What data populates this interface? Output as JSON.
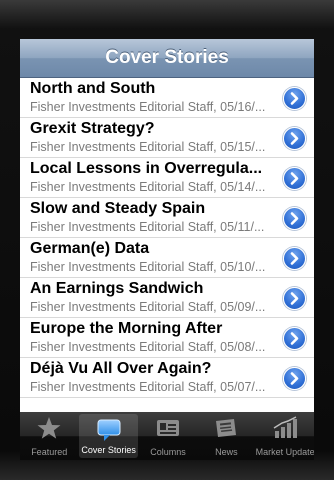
{
  "nav": {
    "title": "Cover Stories"
  },
  "stories": [
    {
      "title": "North and South",
      "subtitle": "Fisher Investments Editorial Staff, 05/16/..."
    },
    {
      "title": "Grexit Strategy?",
      "subtitle": "Fisher Investments Editorial Staff, 05/15/..."
    },
    {
      "title": "Local Lessons in Overregula...",
      "subtitle": "Fisher Investments Editorial Staff, 05/14/..."
    },
    {
      "title": "Slow and Steady Spain",
      "subtitle": "Fisher Investments Editorial Staff, 05/11/..."
    },
    {
      "title": "German(e) Data",
      "subtitle": "Fisher Investments Editorial Staff, 05/10/..."
    },
    {
      "title": "An Earnings Sandwich",
      "subtitle": "Fisher Investments Editorial Staff, 05/09/..."
    },
    {
      "title": "Europe the Morning After",
      "subtitle": "Fisher Investments Editorial Staff, 05/08/..."
    },
    {
      "title": "Déjà Vu All Over Again?",
      "subtitle": "Fisher Investments Editorial Staff, 05/07/..."
    }
  ],
  "tabs": [
    {
      "label": "Featured",
      "icon": "star-icon",
      "active": false
    },
    {
      "label": "Cover Stories",
      "icon": "speech-bubble-icon",
      "active": true
    },
    {
      "label": "Columns",
      "icon": "id-card-icon",
      "active": false
    },
    {
      "label": "News",
      "icon": "newspaper-icon",
      "active": false
    },
    {
      "label": "Market Updates",
      "icon": "bar-chart-icon",
      "active": false
    }
  ],
  "colors": {
    "navbar": "#7a94b2",
    "accent": "#2f6fd6",
    "tabbar": "#0d0d0d"
  }
}
